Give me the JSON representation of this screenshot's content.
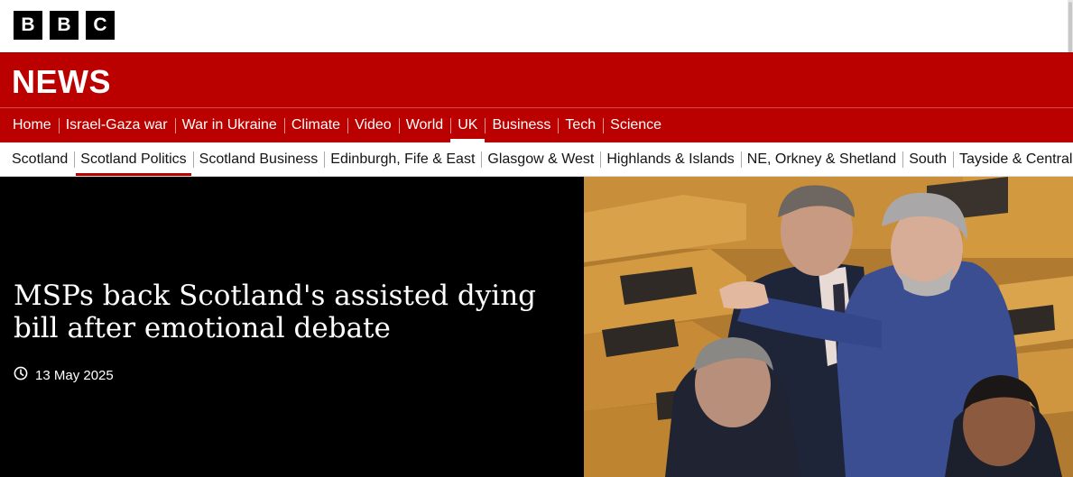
{
  "logo": {
    "letters": [
      "B",
      "B",
      "C"
    ]
  },
  "brand": {
    "section_title": "NEWS"
  },
  "main_nav": [
    {
      "label": "Home",
      "active": false
    },
    {
      "label": "Israel-Gaza war",
      "active": false
    },
    {
      "label": "War in Ukraine",
      "active": false
    },
    {
      "label": "Climate",
      "active": false
    },
    {
      "label": "Video",
      "active": false
    },
    {
      "label": "World",
      "active": false
    },
    {
      "label": "UK",
      "active": true
    },
    {
      "label": "Business",
      "active": false
    },
    {
      "label": "Tech",
      "active": false
    },
    {
      "label": "Science",
      "active": false
    }
  ],
  "sub_nav": [
    {
      "label": "Scotland",
      "active": false
    },
    {
      "label": "Scotland Politics",
      "active": true
    },
    {
      "label": "Scotland Business",
      "active": false
    },
    {
      "label": "Edinburgh, Fife & East",
      "active": false
    },
    {
      "label": "Glasgow & West",
      "active": false
    },
    {
      "label": "Highlands & Islands",
      "active": false
    },
    {
      "label": "NE, Orkney & Shetland",
      "active": false
    },
    {
      "label": "South",
      "active": false
    },
    {
      "label": "Tayside & Central",
      "active": false
    }
  ],
  "hero": {
    "headline": "MSPs back Scotland's assisted dying bill after emotional debate",
    "date": "13 May 2025",
    "date_icon": "clock-icon",
    "image_icon": "photo"
  },
  "colors": {
    "brand_red": "#bb0000",
    "hero_bg": "#000000"
  }
}
